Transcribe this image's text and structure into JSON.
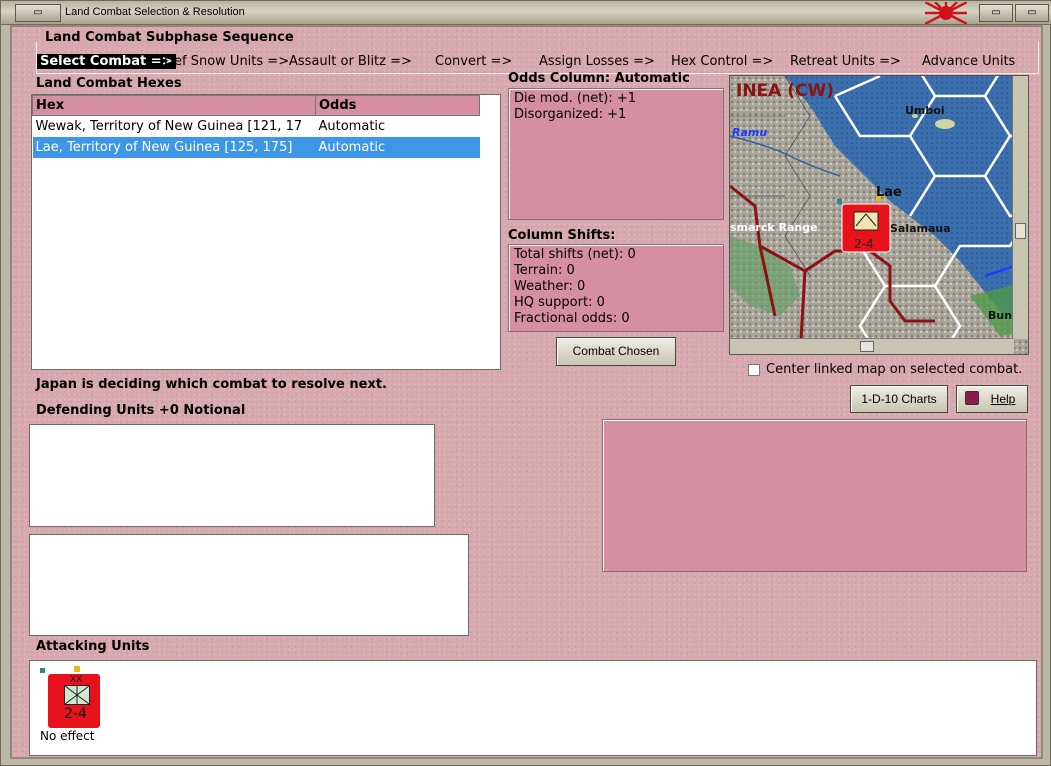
{
  "window": {
    "title": "Land Combat Selection & Resolution"
  },
  "sequence": {
    "title": "Land Combat Subphase Sequence",
    "steps": [
      "Select Combat =>",
      "Def Snow Units =>",
      "Assault or Blitz =>",
      "Convert =>",
      "Assign Losses =>",
      "Hex Control =>",
      "Retreat Units =>",
      "Advance Units"
    ]
  },
  "hexes": {
    "title": "Land Combat Hexes",
    "columns": [
      "Hex",
      "Odds"
    ],
    "rows": [
      {
        "hex": "Wewak, Territory of New Guinea [121, 17",
        "odds": "Automatic"
      },
      {
        "hex": "Lae, Territory of New Guinea [125, 175]",
        "odds": "Automatic"
      }
    ]
  },
  "odds": {
    "title": "Odds Column: Automatic",
    "lines": [
      "Die mod. (net): +1",
      "Disorganized: +1"
    ]
  },
  "shifts": {
    "title": "Column Shifts:",
    "lines": [
      "Total shifts (net): 0",
      "Terrain: 0",
      "Weather: 0",
      "HQ support: 0",
      "Fractional odds: 0"
    ]
  },
  "buttons": {
    "combat_chosen": "Combat Chosen",
    "charts": "1-D-10 Charts",
    "help": "Help"
  },
  "map": {
    "region": "INEA (CW)",
    "labels": [
      "Umboi",
      "Ramu",
      "Lae",
      "smarck Range",
      "Salamaua",
      "Bun"
    ],
    "unit_strength": "2-4",
    "center_checkbox": {
      "label": "Center linked map on selected combat.",
      "checked": false
    }
  },
  "status": "Japan is deciding which combat to resolve next.",
  "defending": {
    "title": "Defending Units +0 Notional"
  },
  "attacking": {
    "title": "Attacking Units",
    "unit": {
      "strength": "2-4",
      "size": "XX",
      "result": "No effect"
    }
  },
  "colors": {
    "panel": "#d68ea3",
    "selection": "#3d96e6",
    "counter": "#e8121c"
  }
}
